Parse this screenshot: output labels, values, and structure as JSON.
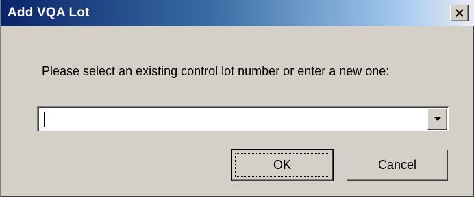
{
  "window": {
    "title": "Add VQA Lot",
    "close_icon": "close-icon"
  },
  "main": {
    "prompt": "Please select an existing control lot number or enter a new one:",
    "lot_combo": {
      "value": "",
      "dropdown_icon": "chevron-down-icon"
    }
  },
  "buttons": {
    "ok_label": "OK",
    "cancel_label": "Cancel"
  },
  "colors": {
    "title_bar_start": "#0a246a",
    "title_bar_end": "#a6caf0",
    "dialog_face": "#d4d0c8"
  }
}
